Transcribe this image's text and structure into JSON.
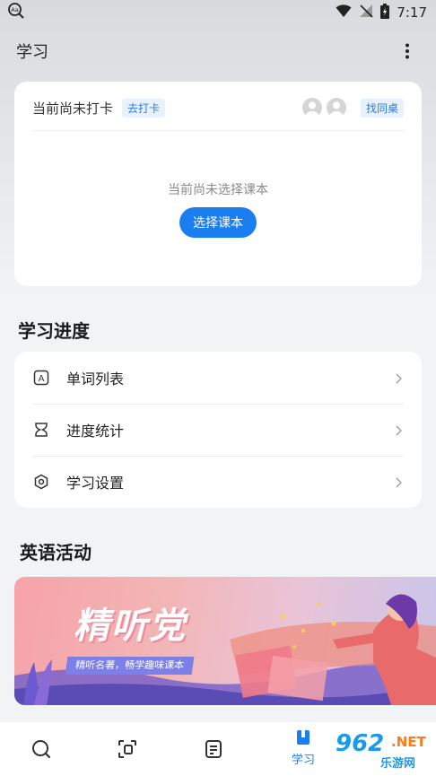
{
  "status_bar": {
    "time": "7:17",
    "icons": [
      "font-size-search-icon",
      "wifi-icon",
      "no-signal-icon",
      "battery-icon"
    ]
  },
  "header": {
    "title": "学习",
    "more_icon": "more-vertical-icon"
  },
  "checkin": {
    "status_text": "当前尚未打卡",
    "checkin_button": "去打卡",
    "find_deskmate_button": "找同桌",
    "no_book_text": "当前尚未选择课本",
    "select_book_button": "选择课本"
  },
  "progress": {
    "title": "学习进度",
    "items": [
      {
        "label": "单词列表",
        "icon": "word-list-icon"
      },
      {
        "label": "进度统计",
        "icon": "hourglass-icon"
      },
      {
        "label": "学习设置",
        "icon": "settings-hexagon-icon"
      }
    ]
  },
  "activities": {
    "title": "英语活动",
    "banner_title": "精听党",
    "banner_subtitle": "精听名著，畅学趣味课本"
  },
  "bottom_nav": {
    "items": [
      {
        "icon": "search-icon"
      },
      {
        "icon": "scan-icon"
      },
      {
        "icon": "document-icon"
      },
      {
        "icon": "learn-icon",
        "label": "学习",
        "active": true
      }
    ]
  },
  "watermark": {
    "main": "962",
    "net": ".NET",
    "sub": "乐游网"
  },
  "colors": {
    "accent": "#1a7ef0",
    "tag_bg": "#e8f1fd",
    "page_bg": "#f2f3f5"
  }
}
